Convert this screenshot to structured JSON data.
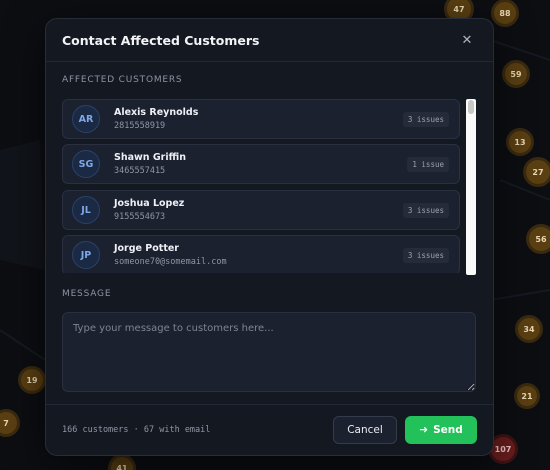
{
  "map": {
    "clusters": [
      {
        "label": "47",
        "kind": "orange"
      },
      {
        "label": "88",
        "kind": "orange"
      },
      {
        "label": "59",
        "kind": "orange"
      },
      {
        "label": "13",
        "kind": "orange"
      },
      {
        "label": "27",
        "kind": "orange"
      },
      {
        "label": "56",
        "kind": "orange"
      },
      {
        "label": "34",
        "kind": "orange"
      },
      {
        "label": "21",
        "kind": "orange"
      },
      {
        "label": "19",
        "kind": "orange"
      },
      {
        "label": "7",
        "kind": "orange"
      },
      {
        "label": "41",
        "kind": "orange"
      },
      {
        "label": "107",
        "kind": "red"
      }
    ]
  },
  "modal": {
    "title": "Contact Affected Customers",
    "close_icon": "close-icon",
    "affected_label": "AFFECTED CUSTOMERS",
    "customers": [
      {
        "initials": "AR",
        "name": "Alexis Reynolds",
        "contact": "2815558919",
        "issues": "3 issues"
      },
      {
        "initials": "SG",
        "name": "Shawn Griffin",
        "contact": "3465557415",
        "issues": "1 issue"
      },
      {
        "initials": "JL",
        "name": "Joshua Lopez",
        "contact": "9155554673",
        "issues": "3 issues"
      },
      {
        "initials": "JP",
        "name": "Jorge Potter",
        "contact": "someone70@somemail.com",
        "issues": "3 issues"
      }
    ],
    "message_label": "MESSAGE",
    "message_placeholder": "Type your message to customers here...",
    "message_value": "",
    "footer_stats": "166 customers · 67 with email",
    "cancel_label": "Cancel",
    "send_label": "Send",
    "send_icon": "arrow-right-icon"
  },
  "colors": {
    "accent_send": "#22c15a",
    "avatar_text": "#7fa7e6",
    "cluster_orange": "#5a3f12",
    "cluster_red": "#6a1d1d"
  }
}
